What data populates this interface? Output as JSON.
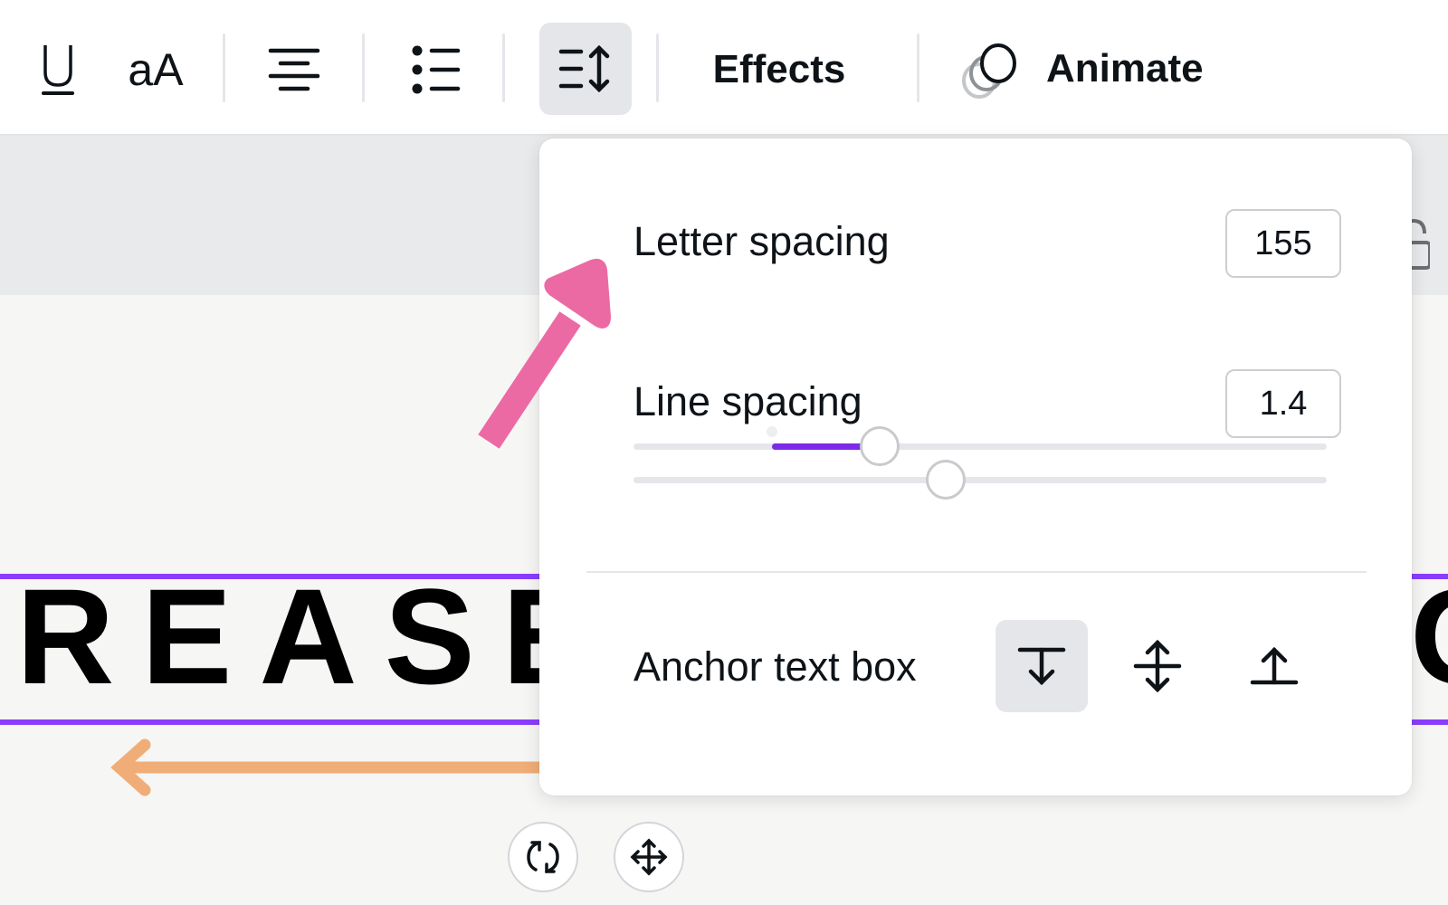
{
  "toolbar": {
    "underline_icon": "underline-icon",
    "case_icon_label": "aA",
    "align_icon": "align-center-icon",
    "list_icon": "bulleted-list-icon",
    "spacing_icon": "spacing-icon",
    "effects_label": "Effects",
    "animate_label": "Animate",
    "animate_icon": "animate-icon"
  },
  "spacing_panel": {
    "letter_spacing": {
      "label": "Letter spacing",
      "value": "155",
      "min": -200,
      "max": 800,
      "current": 155
    },
    "line_spacing": {
      "label": "Line spacing",
      "value": "1.4",
      "min": 0.5,
      "max": 2.5,
      "current": 1.4
    },
    "anchor": {
      "label": "Anchor text box",
      "options": [
        {
          "name": "anchor-top",
          "icon": "anchor-top-icon",
          "active": true
        },
        {
          "name": "anchor-middle",
          "icon": "anchor-middle-icon",
          "active": false
        },
        {
          "name": "anchor-bottom",
          "icon": "anchor-bottom-icon",
          "active": false
        }
      ]
    }
  },
  "canvas": {
    "text_left": "REASEI",
    "text_right": "G"
  },
  "colors": {
    "accent": "#7d2ae8",
    "selection": "#8b3dff",
    "annotation_arrow": "#ec6aa3",
    "orange_arrow": "#f0ad78"
  },
  "element_controls": {
    "rotate_icon": "rotate-icon",
    "move_icon": "move-icon"
  }
}
